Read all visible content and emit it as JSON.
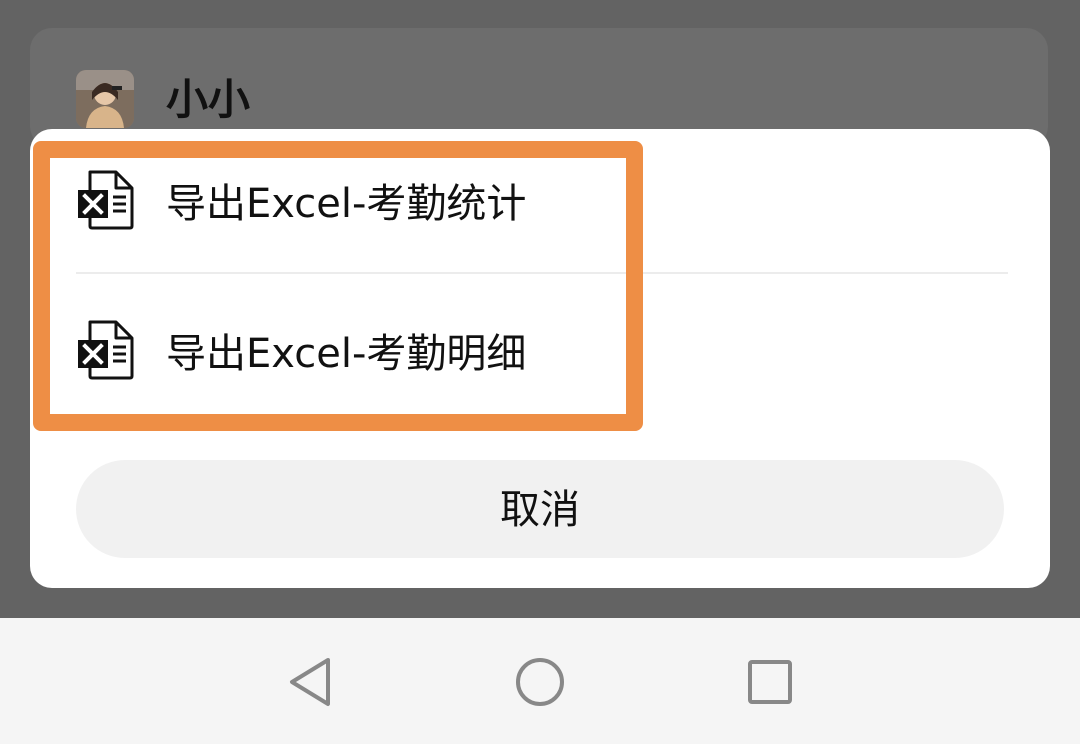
{
  "background": {
    "user": {
      "name": "小小",
      "avatar_icon": "avatar"
    }
  },
  "sheet": {
    "items": [
      {
        "label": "导出Excel-考勤统计",
        "icon": "excel-file-icon"
      },
      {
        "label": "导出Excel-考勤明细",
        "icon": "excel-file-icon"
      }
    ],
    "cancel_label": "取消"
  },
  "nav_bar": {
    "back_icon": "back-icon",
    "home_icon": "home-icon",
    "recent_icon": "recent-apps-icon"
  },
  "colors": {
    "overlay": "#636363",
    "sheet": "#ffffff",
    "highlight_border": "#ee8e45",
    "cancel_bg": "#f1f1f1",
    "nav_bg": "#f5f5f5"
  }
}
